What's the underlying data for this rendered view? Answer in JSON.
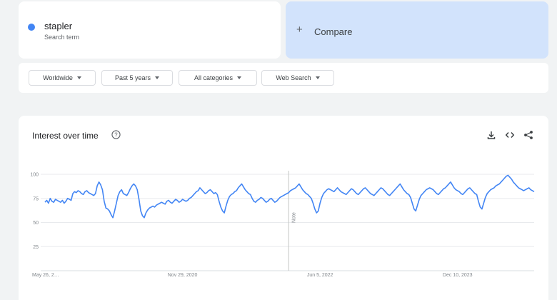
{
  "search_term": {
    "name": "stapler",
    "sub_label": "Search term",
    "color": "#4285f4"
  },
  "compare": {
    "label": "Compare"
  },
  "filters": [
    {
      "label": "Worldwide"
    },
    {
      "label": "Past 5 years"
    },
    {
      "label": "All categories"
    },
    {
      "label": "Web Search"
    }
  ],
  "chart_card": {
    "title": "Interest over time",
    "icons": [
      "help-icon",
      "download-icon",
      "embed-icon",
      "share-icon"
    ]
  },
  "chart_data": {
    "type": "line",
    "title": "Interest over time",
    "xlabel": "",
    "ylabel": "",
    "ylim": [
      0,
      100
    ],
    "y_ticks": [
      25,
      50,
      75,
      100
    ],
    "grid": true,
    "x_ticks": [
      {
        "label": "May 26, 2…",
        "week": 0
      },
      {
        "label": "Nov 29, 2020",
        "week": 79
      },
      {
        "label": "Jun 5, 2022",
        "week": 158
      },
      {
        "label": "Dec 10, 2023",
        "week": 237
      }
    ],
    "annotation": {
      "label": "Note",
      "week": 140
    },
    "series": [
      {
        "name": "stapler",
        "color": "#4285f4",
        "values": [
          71,
          73,
          70,
          75,
          72,
          71,
          74,
          73,
          72,
          71,
          73,
          70,
          72,
          75,
          74,
          73,
          80,
          82,
          81,
          83,
          82,
          80,
          79,
          82,
          83,
          81,
          80,
          79,
          78,
          80,
          88,
          92,
          89,
          84,
          72,
          65,
          64,
          62,
          58,
          55,
          62,
          70,
          78,
          82,
          84,
          80,
          79,
          78,
          81,
          85,
          88,
          90,
          88,
          84,
          74,
          62,
          57,
          55,
          60,
          63,
          65,
          66,
          67,
          66,
          68,
          69,
          70,
          71,
          70,
          69,
          72,
          73,
          71,
          70,
          72,
          74,
          73,
          71,
          72,
          74,
          73,
          72,
          73,
          75,
          76,
          78,
          80,
          82,
          83,
          86,
          84,
          82,
          80,
          81,
          83,
          84,
          82,
          80,
          81,
          79,
          72,
          66,
          62,
          60,
          67,
          73,
          77,
          79,
          80,
          82,
          83,
          86,
          88,
          90,
          87,
          84,
          82,
          80,
          79,
          75,
          72,
          71,
          73,
          74,
          76,
          75,
          73,
          71,
          72,
          74,
          75,
          73,
          71,
          72,
          74,
          76,
          77,
          78,
          79,
          80,
          81,
          83,
          84,
          85,
          86,
          88,
          90,
          87,
          84,
          82,
          80,
          79,
          77,
          75,
          70,
          64,
          60,
          62,
          70,
          76,
          80,
          82,
          84,
          85,
          84,
          83,
          82,
          84,
          86,
          84,
          82,
          81,
          80,
          79,
          81,
          83,
          85,
          84,
          82,
          80,
          79,
          81,
          83,
          85,
          86,
          84,
          82,
          80,
          79,
          78,
          80,
          82,
          84,
          86,
          85,
          83,
          81,
          79,
          78,
          80,
          82,
          84,
          86,
          88,
          90,
          87,
          84,
          82,
          80,
          79,
          76,
          70,
          64,
          62,
          68,
          74,
          78,
          80,
          82,
          84,
          85,
          86,
          85,
          84,
          82,
          80,
          79,
          81,
          83,
          85,
          86,
          88,
          90,
          92,
          89,
          86,
          84,
          83,
          82,
          80,
          79,
          81,
          83,
          85,
          86,
          84,
          82,
          80,
          79,
          72,
          66,
          64,
          70,
          76,
          80,
          82,
          84,
          85,
          86,
          88,
          89,
          90,
          92,
          94,
          96,
          98,
          99,
          97,
          95,
          92,
          90,
          88,
          86,
          85,
          84,
          83,
          84,
          85,
          86,
          84,
          83,
          82
        ]
      }
    ]
  }
}
